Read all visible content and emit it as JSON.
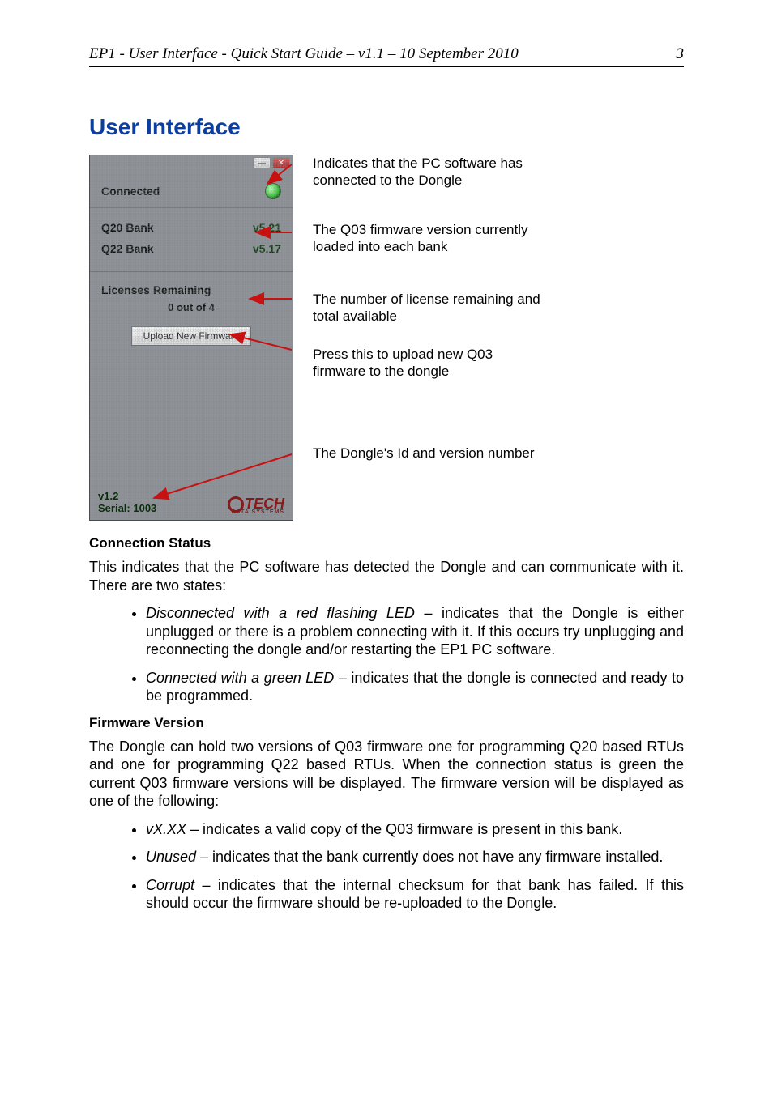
{
  "header": {
    "left": "EP1 - User Interface - Quick Start Guide – v1.1 – 10 September 2010",
    "right": "3"
  },
  "title": "User Interface",
  "app": {
    "status_label": "Connected",
    "banks": [
      {
        "name": "Q20 Bank",
        "version": "v5.21"
      },
      {
        "name": "Q22 Bank",
        "version": "v5.17"
      }
    ],
    "licenses_title": "Licenses Remaining",
    "licenses_count": "0 out of 4",
    "upload_btn": "Upload New Firmware",
    "footer_version": "v1.2",
    "footer_serial": "Serial: 1003",
    "logo_text": "TECH",
    "logo_sub": "DATA SYSTEMS",
    "win_min": "—",
    "win_close": "✕"
  },
  "callouts": {
    "connected": "Indicates that the PC software has connected to the Dongle",
    "version": "The Q03 firmware version currently loaded into each bank",
    "licenses": "The number of license remaining and total available",
    "upload": "Press this to upload new Q03 firmware to the dongle",
    "footer": "The Dongle's Id and version number"
  },
  "sections": {
    "conn_title": "Connection Status",
    "conn_para": "This indicates that the PC software has detected the Dongle and can communicate with it. There are two states:",
    "conn_b1_lead": "Disconnected with a red flashing LED",
    "conn_b1_rest": " – indicates that the Dongle is either unplugged or there is a problem connecting with it. If this occurs try unplugging and reconnecting the dongle and/or restarting the EP1 PC software.",
    "conn_b2_lead": "Connected with a green LED",
    "conn_b2_rest": " – indicates that the dongle is connected and ready to be programmed.",
    "fw_title": "Firmware Version",
    "fw_para": "The Dongle can hold two versions of Q03 firmware one for programming Q20 based RTUs and one for programming Q22 based RTUs. When the connection status is green the current Q03 firmware versions will be displayed. The firmware version will be displayed as one of the following:",
    "fw_b1_lead": "vX.XX",
    "fw_b1_rest": " – indicates a valid copy of the Q03 firmware is present in this bank.",
    "fw_b2_lead": "Unused",
    "fw_b2_rest": " – indicates that the bank currently does not have any firmware installed.",
    "fw_b3_lead": "Corrupt",
    "fw_b3_rest": " – indicates that the internal checksum for that bank has failed. If this should occur the firmware should be re-uploaded to the Dongle."
  }
}
